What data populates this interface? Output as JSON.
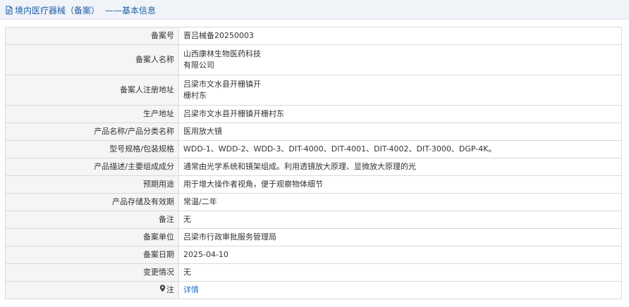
{
  "header": {
    "title": "境内医疗器械（备案）",
    "subtitle": "——基本信息"
  },
  "rows": [
    {
      "label": "备案号",
      "value": "晋吕械备20250003"
    },
    {
      "label": "备案人名称",
      "value_lines": [
        "山西康林生物医药科技",
        "有限公司"
      ]
    },
    {
      "label": "备案人注册地址",
      "value_lines": [
        "吕梁市文水县开栅镇开",
        "栅村东"
      ]
    },
    {
      "label": "生产地址",
      "value": "吕梁市文水县开栅镇开栅村东"
    },
    {
      "label": "产品名称/产品分类名称",
      "value": "医用放大镜"
    },
    {
      "label": "型号规格/包装规格",
      "value": "WDD-1、WDD-2、WDD-3、DIT-4000、DIT-4001、DIT-4002、DIT-3000、DGP-4K。"
    },
    {
      "label": "产品描述/主要组成成分",
      "value": "通常由光学系统和镜架组成。利用透镜放大原理、显微放大原理的光"
    },
    {
      "label": "预期用途",
      "value": "用于增大操作者视角，便于观察物体细节"
    },
    {
      "label": "产品存储及有效期",
      "value": "常温/二年"
    },
    {
      "label": "备注",
      "value": "无"
    },
    {
      "label": "备案单位",
      "value": "吕梁市行政审批服务管理局"
    },
    {
      "label": "备案日期",
      "value": "2025-04-10"
    },
    {
      "label": "变更情况",
      "value": "无"
    },
    {
      "label": "注",
      "value": "详情"
    }
  ],
  "icons": {
    "title_icon": "document-icon",
    "note_icon": "location-pin-icon"
  },
  "colors": {
    "accent": "#1f5fa8",
    "link": "#1f6fc4",
    "label_bg": "#f5f5f5",
    "header_bg": "#f0f3f8"
  }
}
